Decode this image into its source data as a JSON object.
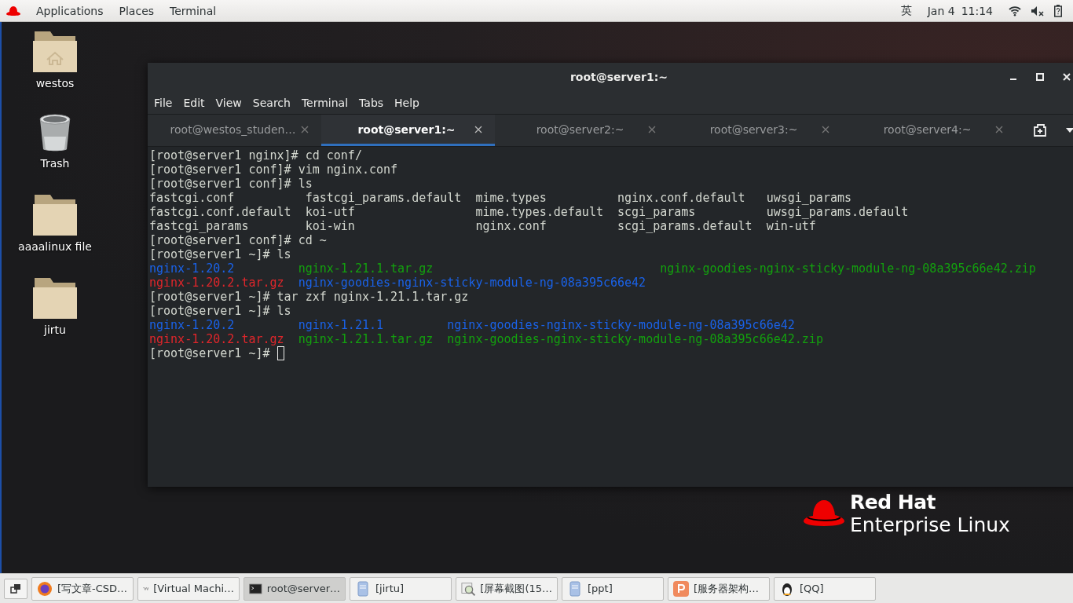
{
  "top_bar": {
    "menus": [
      {
        "label": "Applications"
      },
      {
        "label": "Places"
      },
      {
        "label": "Terminal"
      }
    ],
    "input_method": "英",
    "date": "Jan 4",
    "time": "11:14"
  },
  "desktop_icons": [
    {
      "label": "westos",
      "kind": "home"
    },
    {
      "label": "Trash",
      "kind": "trash"
    },
    {
      "label": "aaaalinux file",
      "kind": "folder"
    },
    {
      "label": "jirtu",
      "kind": "folder"
    }
  ],
  "window": {
    "title": "root@server1:~",
    "menu": [
      "File",
      "Edit",
      "View",
      "Search",
      "Terminal",
      "Tabs",
      "Help"
    ],
    "tabs": [
      {
        "label": "root@westos_studen…",
        "selected": false
      },
      {
        "label": "root@server1:~",
        "selected": true
      },
      {
        "label": "root@server2:~",
        "selected": false
      },
      {
        "label": "root@server3:~",
        "selected": false
      },
      {
        "label": "root@server4:~",
        "selected": false
      }
    ],
    "terminal": [
      {
        "kind": "text",
        "text": "[root@server1 nginx]# cd conf/"
      },
      {
        "kind": "text",
        "text": "[root@server1 conf]# vim nginx.conf"
      },
      {
        "kind": "text",
        "text": "[root@server1 conf]# ls"
      },
      {
        "kind": "listing",
        "rows": [
          [
            {
              "text": "fastcgi.conf",
              "color": "#d3d7cf"
            },
            {
              "text": "fastcgi_params.default",
              "color": "#d3d7cf"
            },
            {
              "text": "mime.types",
              "color": "#d3d7cf"
            },
            {
              "text": "nginx.conf.default",
              "color": "#d3d7cf"
            },
            {
              "text": "uwsgi_params",
              "color": "#d3d7cf"
            }
          ],
          [
            {
              "text": "fastcgi.conf.default",
              "color": "#d3d7cf"
            },
            {
              "text": "koi-utf",
              "color": "#d3d7cf"
            },
            {
              "text": "mime.types.default",
              "color": "#d3d7cf"
            },
            {
              "text": "scgi_params",
              "color": "#d3d7cf"
            },
            {
              "text": "uwsgi_params.default",
              "color": "#d3d7cf"
            }
          ],
          [
            {
              "text": "fastcgi_params",
              "color": "#d3d7cf"
            },
            {
              "text": "koi-win",
              "color": "#d3d7cf"
            },
            {
              "text": "nginx.conf",
              "color": "#d3d7cf"
            },
            {
              "text": "scgi_params.default",
              "color": "#d3d7cf"
            },
            {
              "text": "win-utf",
              "color": "#d3d7cf"
            }
          ]
        ]
      },
      {
        "kind": "text",
        "text": "[root@server1 conf]# cd ~"
      },
      {
        "kind": "text",
        "text": "[root@server1 ~]# ls"
      },
      {
        "kind": "listing",
        "rows": [
          [
            {
              "text": "nginx-1.20.2",
              "color": "#1a62e8"
            },
            {
              "text": "nginx-1.21.1.tar.gz",
              "color": "#13a10e"
            },
            {
              "text": "nginx-goodies-nginx-sticky-module-ng-08a395c66e42.zip",
              "color": "#13a10e"
            }
          ],
          [
            {
              "text": "nginx-1.20.2.tar.gz",
              "color": "#e0262b"
            },
            {
              "text": "nginx-goodies-nginx-sticky-module-ng-08a395c66e42",
              "color": "#1a62e8"
            }
          ]
        ]
      },
      {
        "kind": "text",
        "text": "[root@server1 ~]# tar zxf nginx-1.21.1.tar.gz"
      },
      {
        "kind": "text",
        "text": "[root@server1 ~]# ls"
      },
      {
        "kind": "listing",
        "rows": [
          [
            {
              "text": "nginx-1.20.2",
              "color": "#1a62e8"
            },
            {
              "text": "nginx-1.21.1",
              "color": "#1a62e8"
            },
            {
              "text": "nginx-goodies-nginx-sticky-module-ng-08a395c66e42",
              "color": "#1a62e8"
            }
          ],
          [
            {
              "text": "nginx-1.20.2.tar.gz",
              "color": "#e0262b"
            },
            {
              "text": "nginx-1.21.1.tar.gz",
              "color": "#13a10e"
            },
            {
              "text": "nginx-goodies-nginx-sticky-module-ng-08a395c66e42.zip",
              "color": "#13a10e"
            }
          ]
        ]
      },
      {
        "kind": "prompt",
        "text": "[root@server1 ~]#"
      }
    ]
  },
  "wallpaper_logo": {
    "brand": "Red Hat",
    "product": "Enterprise Linux"
  },
  "taskbar": [
    {
      "label": "[写文章-CSD…",
      "kind": "browser",
      "selected": false
    },
    {
      "label": "[Virtual Machi…",
      "kind": "vm",
      "selected": false
    },
    {
      "label": "root@server…",
      "kind": "terminal",
      "selected": true
    },
    {
      "label": "[jirtu]",
      "kind": "document",
      "selected": false
    },
    {
      "label": "[屏幕截图(15…",
      "kind": "screenshot",
      "selected": false
    },
    {
      "label": "[ppt]",
      "kind": "document",
      "selected": false
    },
    {
      "label": "[服务器架构…",
      "kind": "slides",
      "selected": false
    },
    {
      "label": "[QQ]",
      "kind": "penguin",
      "selected": false
    }
  ]
}
